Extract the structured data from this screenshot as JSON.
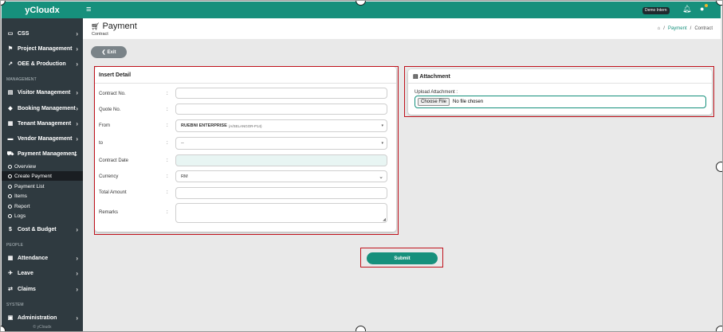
{
  "app": {
    "logo": "yCloudx"
  },
  "topbar": {
    "badge": "Demo Intern"
  },
  "sidebar": {
    "items_top": [
      {
        "label": "CSS",
        "icon": "monitor-icon"
      },
      {
        "label": "Project Management",
        "icon": "flag-icon"
      },
      {
        "label": "OEE & Production",
        "icon": "chart-line-icon"
      }
    ],
    "section_management": "MANAGEMENT",
    "items_management": [
      {
        "label": "Visitor Management",
        "icon": "id-card-icon"
      },
      {
        "label": "Booking Management",
        "icon": "tag-icon"
      },
      {
        "label": "Tenant Management",
        "icon": "building-icon"
      },
      {
        "label": "Vendor Management",
        "icon": "truck-icon"
      },
      {
        "label": "Payment Management",
        "icon": "cart-icon"
      }
    ],
    "payment_sub": [
      "Overview",
      "Create Payment",
      "Payment List",
      "Items",
      "Report",
      "Logs"
    ],
    "cost_budget": {
      "label": "Cost & Budget",
      "icon": "dollar-icon"
    },
    "section_people": "PEOPLE",
    "items_people": [
      {
        "label": "Attendance",
        "icon": "calendar-icon"
      },
      {
        "label": "Leave",
        "icon": "plane-icon"
      },
      {
        "label": "Claims",
        "icon": "exchange-icon"
      }
    ],
    "section_system": "SYSTEM",
    "admin": {
      "label": "Administration",
      "icon": "admin-icon"
    },
    "footer": "© yCloudx"
  },
  "header": {
    "title": "Payment",
    "subtitle": "Contract",
    "breadcrumb": {
      "home": "home",
      "link": "Payment",
      "sep": "/",
      "current": "Contract"
    }
  },
  "exit_label": "Exit",
  "insert": {
    "title": "Insert Detail",
    "colon": ":",
    "fields": {
      "contract_no": {
        "label": "Contract No.",
        "value": ""
      },
      "quote_no": {
        "label": "Quote No.",
        "value": ""
      },
      "from": {
        "label": "From",
        "value": "RUEBNI ENTERPRISE",
        "value_sub": "(A/SELANGOR-P14)"
      },
      "to": {
        "label": "to",
        "value": "--"
      },
      "contract_date": {
        "label": "Contract Date",
        "value": ""
      },
      "currency": {
        "label": "Currency",
        "value": "RM"
      },
      "total_amount": {
        "label": "Total Amount",
        "value": ""
      },
      "remarks": {
        "label": "Remarks",
        "value": ""
      }
    }
  },
  "attachment": {
    "title": "Attachment",
    "upload_label": "Upload Attachment :",
    "choose_label": "Choose File",
    "no_file": "No file chosen"
  },
  "submit_label": "Submit"
}
